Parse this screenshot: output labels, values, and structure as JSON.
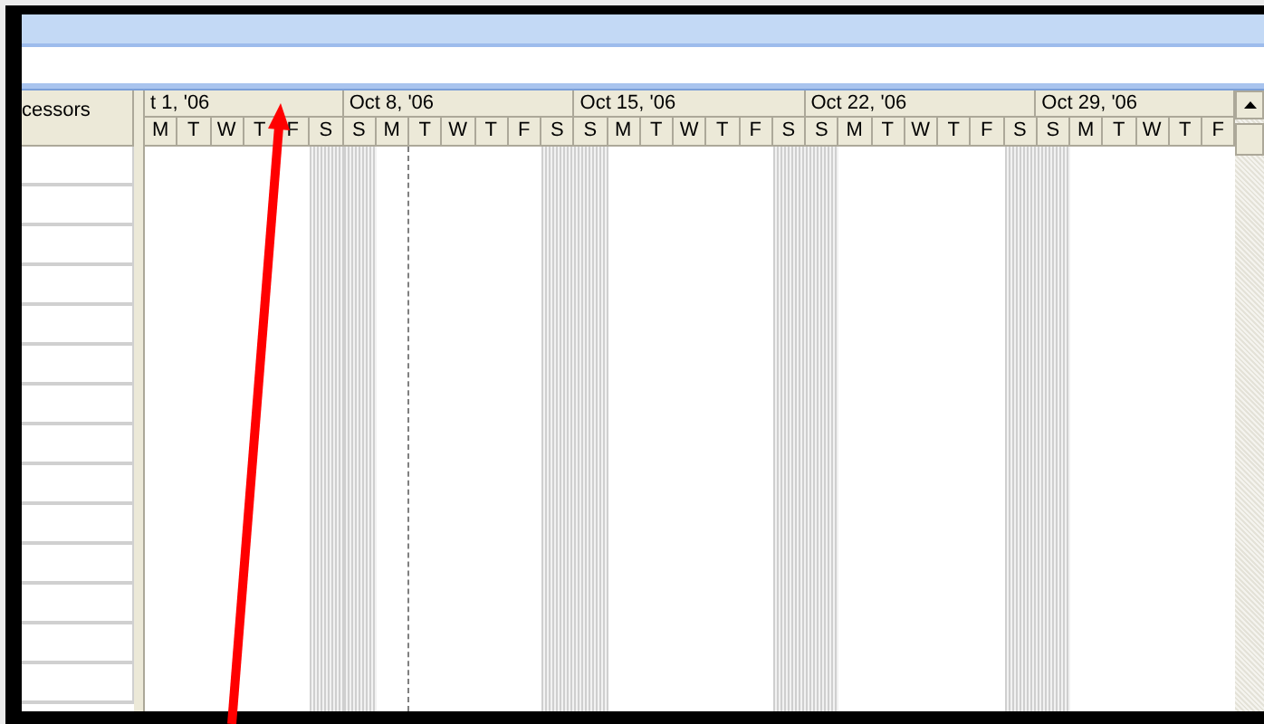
{
  "task_table": {
    "column_header": "cessors"
  },
  "timescale": {
    "weeks": [
      {
        "label": "t 1, '06",
        "days": [
          {
            "letter": "M",
            "weekend": false,
            "current": false
          },
          {
            "letter": "T",
            "weekend": false,
            "current": false
          },
          {
            "letter": "W",
            "weekend": false,
            "current": false
          },
          {
            "letter": "T",
            "weekend": false,
            "current": false
          },
          {
            "letter": "F",
            "weekend": false,
            "current": false
          },
          {
            "letter": "S",
            "weekend": true,
            "current": false
          }
        ]
      },
      {
        "label": "Oct 8, '06",
        "days": [
          {
            "letter": "S",
            "weekend": true,
            "current": false
          },
          {
            "letter": "M",
            "weekend": false,
            "current": true
          },
          {
            "letter": "T",
            "weekend": false,
            "current": false
          },
          {
            "letter": "W",
            "weekend": false,
            "current": false
          },
          {
            "letter": "T",
            "weekend": false,
            "current": false
          },
          {
            "letter": "F",
            "weekend": false,
            "current": false
          },
          {
            "letter": "S",
            "weekend": true,
            "current": false
          }
        ]
      },
      {
        "label": "Oct 15, '06",
        "days": [
          {
            "letter": "S",
            "weekend": true,
            "current": false
          },
          {
            "letter": "M",
            "weekend": false,
            "current": false
          },
          {
            "letter": "T",
            "weekend": false,
            "current": false
          },
          {
            "letter": "W",
            "weekend": false,
            "current": false
          },
          {
            "letter": "T",
            "weekend": false,
            "current": false
          },
          {
            "letter": "F",
            "weekend": false,
            "current": false
          },
          {
            "letter": "S",
            "weekend": true,
            "current": false
          }
        ]
      },
      {
        "label": "Oct 22, '06",
        "days": [
          {
            "letter": "S",
            "weekend": true,
            "current": false
          },
          {
            "letter": "M",
            "weekend": false,
            "current": false
          },
          {
            "letter": "T",
            "weekend": false,
            "current": false
          },
          {
            "letter": "W",
            "weekend": false,
            "current": false
          },
          {
            "letter": "T",
            "weekend": false,
            "current": false
          },
          {
            "letter": "F",
            "weekend": false,
            "current": false
          },
          {
            "letter": "S",
            "weekend": true,
            "current": false
          }
        ]
      },
      {
        "label": "Oct 29, '06",
        "days": [
          {
            "letter": "S",
            "weekend": true,
            "current": false
          },
          {
            "letter": "M",
            "weekend": false,
            "current": false
          },
          {
            "letter": "T",
            "weekend": false,
            "current": false
          },
          {
            "letter": "W",
            "weekend": false,
            "current": false
          },
          {
            "letter": "T",
            "weekend": false,
            "current": false
          },
          {
            "letter": "F",
            "weekend": false,
            "current": false
          }
        ]
      }
    ]
  }
}
